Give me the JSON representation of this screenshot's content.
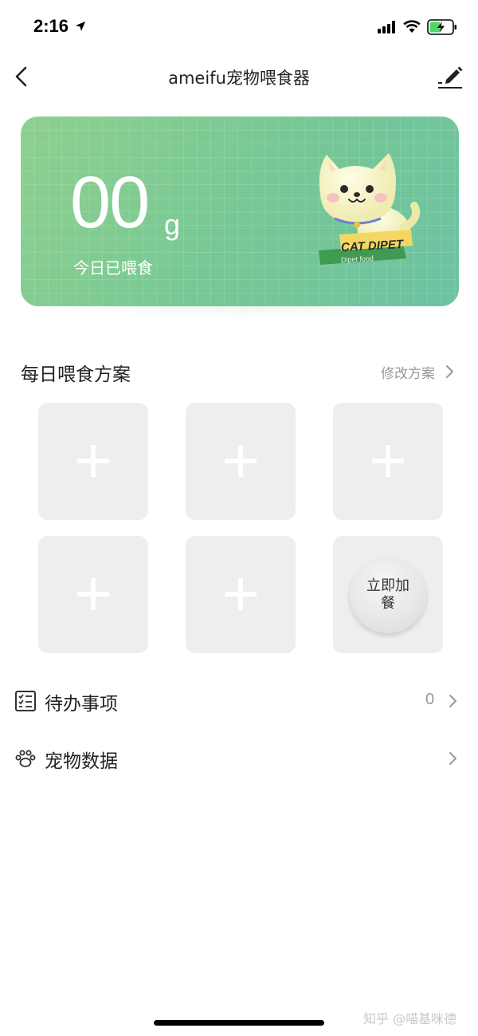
{
  "status_bar": {
    "time": "2:16",
    "icons": [
      "location-arrow-icon",
      "signal-icon",
      "wifi-icon",
      "battery-icon"
    ]
  },
  "nav": {
    "title": "ameifu宠物喂食器",
    "back_icon": "chevron-left-icon",
    "edit_icon": "pencil-icon"
  },
  "hero": {
    "amount": "00",
    "unit": "g",
    "label": "今日已喂食",
    "mascot_badge": "CAT DIPET",
    "mascot_caption": "Dipet food",
    "colors": {
      "gradient_start": "#8ed08f",
      "gradient_end": "#6cc3a2"
    }
  },
  "feeding_plan": {
    "title": "每日喂食方案",
    "modify_label": "修改方案",
    "slots": [
      {
        "state": "empty",
        "icon": "plus-icon"
      },
      {
        "state": "empty",
        "icon": "plus-icon"
      },
      {
        "state": "empty",
        "icon": "plus-icon"
      },
      {
        "state": "empty",
        "icon": "plus-icon"
      },
      {
        "state": "empty",
        "icon": "plus-icon"
      }
    ],
    "feed_now_label": "立即加餐"
  },
  "list": {
    "todo": {
      "label": "待办事项",
      "count": "0",
      "icon": "checklist-icon"
    },
    "pet_data": {
      "label": "宠物数据",
      "icon": "paw-icon"
    }
  },
  "watermark": "知乎 @喵基咪德"
}
